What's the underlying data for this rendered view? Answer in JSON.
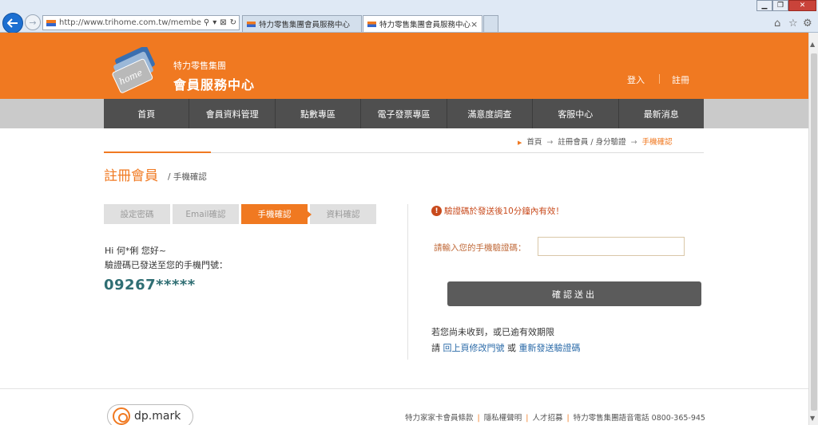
{
  "browser": {
    "url": "http://www.trihome.com.tw/member/che",
    "tabs": [
      {
        "label": "特力零售集團會員服務中心"
      },
      {
        "label": "特力零售集團會員服務中心"
      }
    ],
    "close_glyph": "×"
  },
  "header": {
    "brand_sub": "特力零售集團",
    "brand_main": "會員服務中心",
    "card_text": "home",
    "login": "登入",
    "register": "註冊"
  },
  "nav": {
    "items": [
      "首頁",
      "會員資料管理",
      "點數專區",
      "電子發票專區",
      "滿意度調查",
      "客服中心",
      "最新消息"
    ]
  },
  "breadcrumb": {
    "home": "首頁",
    "level2": "註冊會員 / 身分驗證",
    "current": "手機確認",
    "sep": "→"
  },
  "title": {
    "main": "註冊會員",
    "sub": "/ 手機確認"
  },
  "steps": [
    "設定密碼",
    "Email確認",
    "手機確認",
    "資料確認"
  ],
  "left": {
    "greeting": "Hi 何*俐 您好~",
    "sent_msg": "驗證碼已發送至您的手機門號：",
    "phone": "09267*****"
  },
  "right": {
    "warning": "驗證碼於發送後10分鐘內有效！",
    "code_label": "請輸入您的手機驗證碼：",
    "code_value": "",
    "submit": "確認送出",
    "notice_1": "若您尚未收到，或已逾有效期限",
    "notice_2_prefix": "請",
    "link_back": "回上頁修改門號",
    "notice_2_or": "或",
    "link_resend": "重新發送驗證碼"
  },
  "footer": {
    "logo_text": "dp.mark",
    "links": [
      "特力家家卡會員條款",
      "隱私權聲明",
      "人才招募"
    ],
    "phone_label": "特力零售集團語音電話 0800-365-945"
  },
  "colors": {
    "brand_orange": "#f07921",
    "nav_dark": "#4f4f4f",
    "phone_teal": "#2f6e73",
    "link_blue": "#2a6aa8"
  }
}
